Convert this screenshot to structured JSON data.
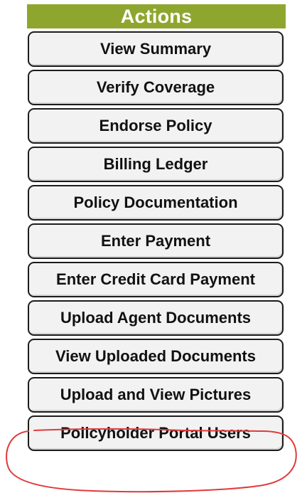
{
  "actions_panel": {
    "title": "Actions",
    "header_color": "#8fa62e",
    "buttons": [
      {
        "label": "View Summary"
      },
      {
        "label": "Verify Coverage"
      },
      {
        "label": "Endorse Policy"
      },
      {
        "label": "Billing Ledger"
      },
      {
        "label": "Policy Documentation"
      },
      {
        "label": "Enter Payment"
      },
      {
        "label": "Enter Credit Card Payment"
      },
      {
        "label": "Upload Agent Documents"
      },
      {
        "label": "View Uploaded Documents"
      },
      {
        "label": "Upload and View Pictures"
      },
      {
        "label": "Policyholder Portal Users"
      }
    ]
  },
  "annotation": {
    "shape": "hand-drawn ellipse",
    "color": "#e03a3a",
    "circled_button": "Policyholder Portal Users"
  }
}
